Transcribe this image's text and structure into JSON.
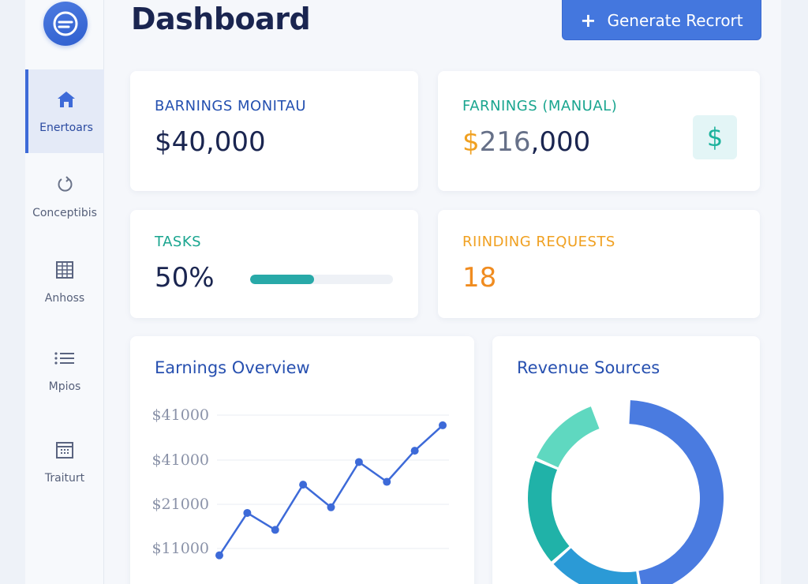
{
  "app": {
    "title": "Dashboard",
    "generate_button_label": "Generate Recrort",
    "generate_button_icon": "plus-icon"
  },
  "sidebar": {
    "logo_icon": "brand-logo-icon",
    "items": [
      {
        "label": "Enertoars",
        "icon": "home-icon",
        "active": true
      },
      {
        "label": "Conceptibis",
        "icon": "refresh-icon",
        "active": false
      },
      {
        "label": "Anhoss",
        "icon": "table-icon",
        "active": false
      },
      {
        "label": "Mpios",
        "icon": "list-icon",
        "active": false
      },
      {
        "label": "Traiturt",
        "icon": "calendar-icon",
        "active": false
      }
    ]
  },
  "stats": {
    "earnings_monitau": {
      "label": "BARNINGS MONITAU",
      "value": "$40,000",
      "label_color": "#2450b0"
    },
    "earnings_manual": {
      "label": "FARNINGS (MANUAL)",
      "value_prefix": "$",
      "value_mid": "216",
      "value_suffix": ",000",
      "label_color": "#19a58f",
      "badge_icon": "dollar-icon",
      "badge_text": "$"
    },
    "tasks": {
      "label": "TASKS",
      "value": "50%",
      "progress": 0.45,
      "label_color": "#19a58f"
    },
    "pending_requests": {
      "label": "RIINDING REQUESTS",
      "value": "18",
      "label_color": "#f0a020"
    }
  },
  "earnings_overview": {
    "title": "Earnings Overview"
  },
  "revenue_sources": {
    "title": "Revenue Sources"
  },
  "chart_data": [
    {
      "type": "line",
      "title": "Earnings Overview",
      "ytick_labels": [
        "$41000",
        "$41000",
        "$21000",
        "$11000"
      ],
      "x": [
        0,
        1,
        2,
        3,
        4,
        5,
        6,
        7,
        8,
        9
      ],
      "series": [
        {
          "values": [
            4000,
            19000,
            13000,
            29000,
            21000,
            37000,
            30000,
            41000,
            50000
          ]
        }
      ],
      "ylim": [
        0,
        55000
      ],
      "grid": true,
      "color": "#3d6ad8"
    },
    {
      "type": "pie",
      "title": "Revenue Sources",
      "donut": true,
      "values": [
        47,
        16,
        18,
        13,
        6
      ],
      "colors": [
        "#4a7be0",
        "#2b9ad6",
        "#20b2a8",
        "#5fd8c0",
        "#ffffff"
      ]
    }
  ]
}
